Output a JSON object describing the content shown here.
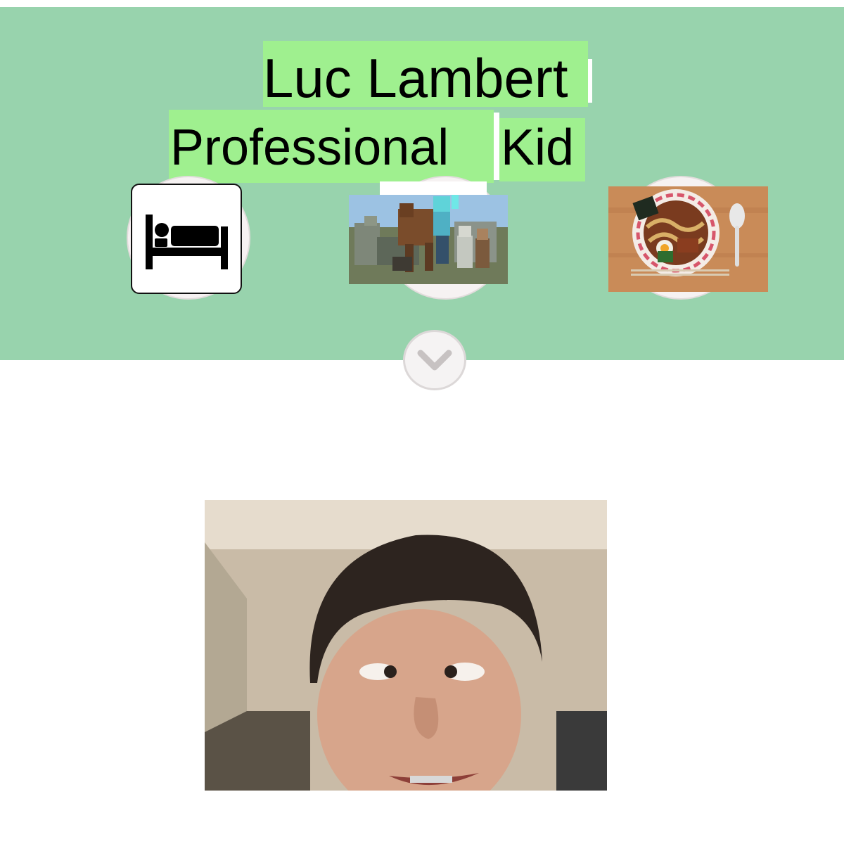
{
  "header": {
    "name": "Luc Lambert",
    "tagline_part1": "Professional",
    "tagline_part2": "Kid",
    "background_color": "#98d3ad",
    "highlight_color": "#9ff08f"
  },
  "interests": [
    {
      "icon": "bed-icon"
    },
    {
      "icon": "minecraft-picture"
    },
    {
      "icon": "ramen-picture"
    }
  ],
  "scroll_button": {
    "icon": "chevron-down-icon"
  },
  "portrait": {
    "icon": "face-photo"
  }
}
